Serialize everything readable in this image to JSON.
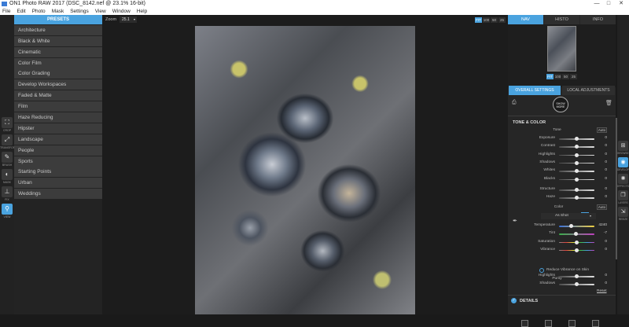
{
  "window": {
    "title": "ON1 Photo RAW 2017 (DSC_8142.nef @ 23.1% 16-bit)",
    "controls": [
      "—",
      "□",
      "✕"
    ]
  },
  "menu": [
    "File",
    "Edit",
    "Photo",
    "Mask",
    "Settings",
    "View",
    "Window",
    "Help"
  ],
  "left_tools": [
    {
      "icon": "crop-icon",
      "glyph": "⛶",
      "label": "CROP",
      "active": false
    },
    {
      "icon": "transform-icon",
      "glyph": "⤢",
      "label": "TRANSFORM",
      "active": false
    },
    {
      "icon": "brush-icon",
      "glyph": "✎",
      "label": "BRUSH",
      "active": false
    },
    {
      "icon": "mask-icon",
      "glyph": "◐",
      "label": "MASK",
      "active": false
    },
    {
      "icon": "stamp-icon",
      "glyph": "⊥",
      "label": "FIX",
      "active": false
    },
    {
      "icon": "zoom-icon",
      "glyph": "⚲",
      "label": "VIEW",
      "active": true
    }
  ],
  "presets": {
    "header": "PRESETS",
    "items": [
      "Architecture",
      "Black & White",
      "Cinematic",
      "Color Film",
      "Color Grading",
      "Develop Workspaces",
      "Faded & Matte",
      "Film",
      "Haze Reducing",
      "Hipster",
      "Landscape",
      "People",
      "Sports",
      "Starting Points",
      "Urban",
      "Weddings"
    ]
  },
  "viewer": {
    "zoom_label": "Zoom",
    "zoom_value": "25.1",
    "zoom_buttons": [
      {
        "label": "FIT",
        "active": true
      },
      {
        "label": "100",
        "active": false
      },
      {
        "label": "50",
        "active": false
      },
      {
        "label": "25",
        "active": false
      }
    ]
  },
  "right_panel": {
    "tabs": [
      {
        "label": "NAV",
        "active": true
      },
      {
        "label": "HISTO",
        "active": false
      },
      {
        "label": "INFO",
        "active": false
      }
    ],
    "nav_zoom": [
      {
        "label": "FIT",
        "active": true
      },
      {
        "label": "100",
        "active": false
      },
      {
        "label": "50",
        "active": false
      },
      {
        "label": "25",
        "active": false
      }
    ],
    "settings_tabs": [
      {
        "label": "OVERALL SETTINGS",
        "active": true
      },
      {
        "label": "LOCAL ADJUSTMENTS",
        "active": false
      }
    ],
    "show_more": [
      "SHOW",
      "MORE"
    ],
    "tone_color": {
      "title": "TONE & COLOR",
      "tone_label": "Tone",
      "auto_label": "Auto",
      "tone_sliders": [
        {
          "label": "Exposure",
          "value": "0",
          "pos": 0.5
        },
        {
          "label": "Contrast",
          "value": "0",
          "pos": 0.5
        },
        {
          "label": "Highlights",
          "value": "0",
          "pos": 0.5
        },
        {
          "label": "Shadows",
          "value": "0",
          "pos": 0.5
        },
        {
          "label": "Whites",
          "value": "0",
          "pos": 0.5
        },
        {
          "label": "Blacks",
          "value": "0",
          "pos": 0.5
        }
      ],
      "detail_sliders": [
        {
          "label": "Structure",
          "value": "0",
          "pos": 0.5
        },
        {
          "label": "Haze",
          "value": "0",
          "pos": 0.5
        }
      ],
      "color_label": "Color",
      "color_auto": "Auto",
      "wb_select": "As Shot",
      "color_sliders": [
        {
          "label": "Temperature",
          "value": "4240",
          "pos": 0.35,
          "track": "temp"
        },
        {
          "label": "Tint",
          "value": "-7",
          "pos": 0.47,
          "track": "tint"
        },
        {
          "label": "Saturation",
          "value": "0",
          "pos": 0.5,
          "track": "sat"
        },
        {
          "label": "Vibrance",
          "value": "0",
          "pos": 0.5,
          "track": "sat"
        }
      ],
      "reduce_vibrance": "Reduce Vibrance on Skin",
      "purity_label": "Purity",
      "purity_sliders": [
        {
          "label": "Highlights",
          "value": "0",
          "pos": 0.5
        },
        {
          "label": "Shadows",
          "value": "0",
          "pos": 0.5
        }
      ],
      "reset": "Reset"
    },
    "details_title": "DETAILS"
  },
  "right_tools": [
    {
      "icon": "browse-icon",
      "glyph": "⊞",
      "label": "BROWSE",
      "active": false
    },
    {
      "icon": "develop-icon",
      "glyph": "◉",
      "label": "DEVELOP",
      "active": true
    },
    {
      "icon": "effects-icon",
      "glyph": "✺",
      "label": "EFFECTS",
      "active": false
    },
    {
      "icon": "layers-icon",
      "glyph": "❐",
      "label": "LAYERS",
      "active": false
    },
    {
      "icon": "resize-icon",
      "glyph": "⇲",
      "label": "RESIZE",
      "active": false
    }
  ],
  "colors": {
    "accent": "#4aa3df"
  }
}
